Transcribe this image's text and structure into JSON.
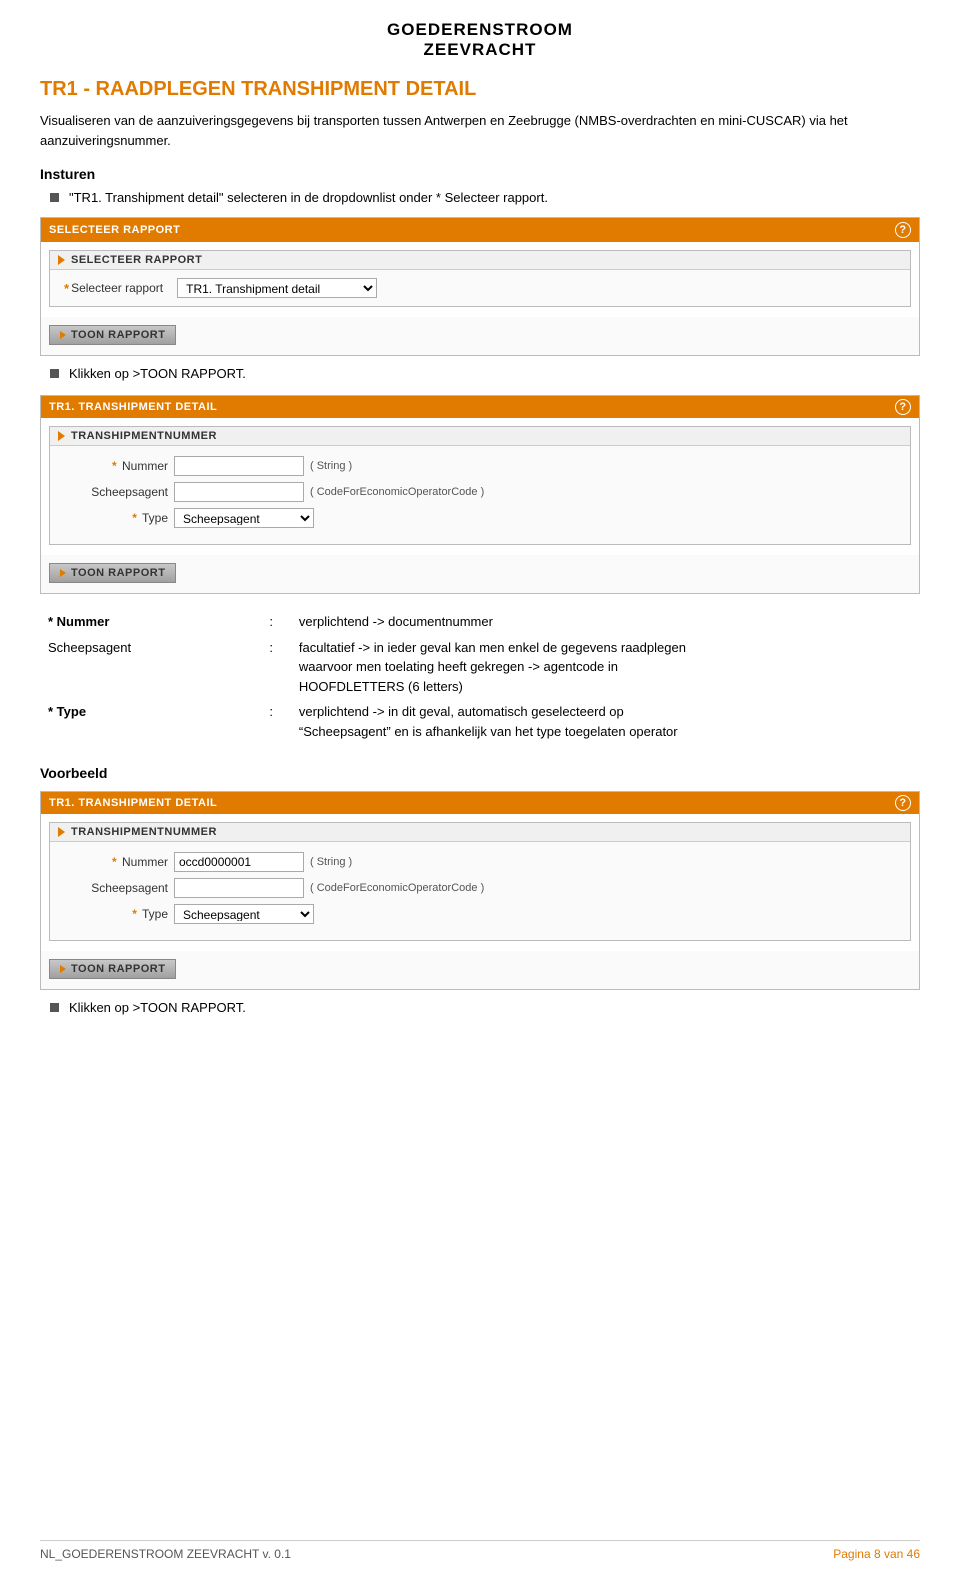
{
  "header": {
    "main_title_line1": "GOEDERENSTROOM",
    "main_title_line2": "ZEEVRACHT"
  },
  "page_title": "TR1 - RAADPLEGEN TRANSHIPMENT DETAIL",
  "description": "Visualiseren van de aanzuiveringsgegevens bij transporten tussen Antwerpen en Zeebrugge (NMBS-overdrachten en mini-CUSCAR) via het aanzuiveringsnummer.",
  "insturen": {
    "title": "Insturen",
    "bullet1": "\"TR1. Transhipment detail\" selecteren in de dropdownlist onder * Selecteer rapport."
  },
  "panel1": {
    "header": "SELECTEER RAPPORT",
    "subheader": "SELECTEER RAPPORT",
    "label_req": "*",
    "label": "Selecteer rapport",
    "select_value": "TR1. Transhipment detail",
    "btn_label": "TOON RAPPORT"
  },
  "bullet2": "Klikken op >TOON RAPPORT.",
  "panel2": {
    "header": "TR1. TRANSHIPMENT DETAIL",
    "subheader": "TRANSHIPMENTNUMMER",
    "fields": [
      {
        "req": "*",
        "label": "Nummer",
        "type_hint": "( String )",
        "value": ""
      },
      {
        "req": "",
        "label": "Scheepsagent",
        "type_hint": "( CodeForEconomicOperatorCode )",
        "value": ""
      },
      {
        "req": "*",
        "label": "Type",
        "type_hint": "",
        "select_value": "Scheepsagent"
      }
    ],
    "btn_label": "TOON RAPPORT"
  },
  "desc_rows": [
    {
      "field": "* Nummer",
      "sep": ":",
      "text": "verplichtend -> documentnummer"
    },
    {
      "field": "Scheepsagent",
      "sep": ":",
      "text": "facultatief -> in ieder geval kan men enkel de gegevens raadplegen waarvoor men toelating heeft gekregen -> agentcode in HOOFDLETTERS (6 letters)"
    },
    {
      "field": "* Type",
      "sep": ":",
      "text": "verplichtend -> in dit geval, automatisch geselecteerd op \"Scheepsagent\" en is afhankelijk van het type toegelaten operator"
    }
  ],
  "voorbeeld": {
    "title": "Voorbeeld",
    "panel": {
      "header": "TR1. TRANSHIPMENT DETAIL",
      "subheader": "TRANSHIPMENTNUMMER",
      "fields": [
        {
          "req": "*",
          "label": "Nummer",
          "type_hint": "( String )",
          "value": "occd0000001"
        },
        {
          "req": "",
          "label": "Scheepsagent",
          "type_hint": "( CodeForEconomicOperatorCode )",
          "value": ""
        },
        {
          "req": "*",
          "label": "Type",
          "type_hint": "",
          "select_value": "Scheepsagent"
        }
      ],
      "btn_label": "TOON RAPPORT"
    },
    "bullet": "Klikken op >TOON RAPPORT."
  },
  "footer": {
    "left": "NL_GOEDERENSTROOM ZEEVRACHT   v. 0.1",
    "right": "Pagina 8 van 46"
  }
}
